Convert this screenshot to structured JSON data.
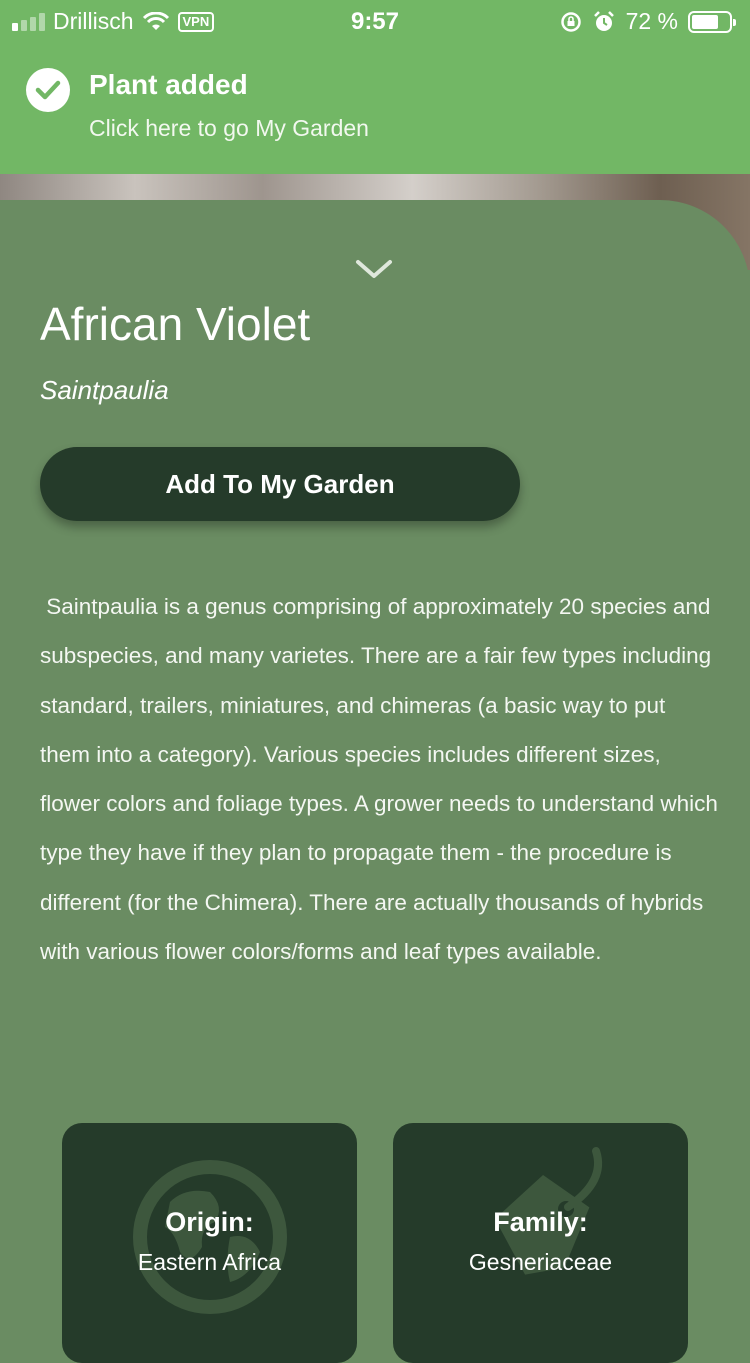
{
  "status_bar": {
    "carrier": "Drillisch",
    "vpn_label": "VPN",
    "time": "9:57",
    "battery_percent": "72 %",
    "battery_level": 0.72,
    "signal_bars_active": 1,
    "signal_bars_total": 4
  },
  "toast": {
    "title": "Plant added",
    "subtitle": "Click here to go My Garden"
  },
  "plant": {
    "name": "African Violet",
    "latin_name": "Saintpaulia",
    "add_button_label": "Add To My Garden",
    "description": " Saintpaulia is a genus comprising of approximately 20 species and subspecies, and many varietes. There are a fair few types including standard, trailers, miniatures, and chimeras (a basic way to put them into a category). Various species includes different sizes, flower colors and foliage types. A grower needs to understand which type they have if they plan to propagate them - the procedure is different (for the Chimera). There are actually thousands of hybrids with various flower colors/forms and leaf types available."
  },
  "info_cards": {
    "origin": {
      "label": "Origin:",
      "value": "Eastern Africa",
      "icon": "globe-icon"
    },
    "family": {
      "label": "Family:",
      "value": "Gesneriaceae",
      "icon": "tag-icon"
    }
  },
  "colors": {
    "banner": "#72b765",
    "card": "#6a8c62",
    "dark": "#253b2a"
  }
}
